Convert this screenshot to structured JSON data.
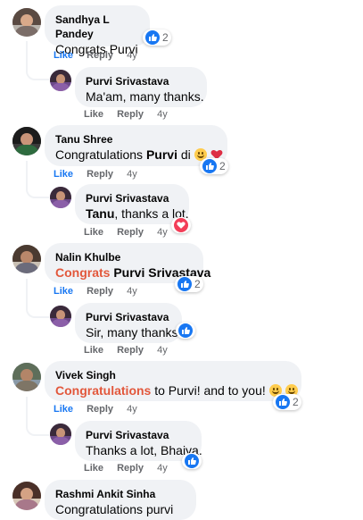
{
  "colors": {
    "accent": "#1877f2",
    "highlight": "#e2573b",
    "bubble": "#f0f2f5",
    "muted": "#65676b",
    "love": "#f33e58"
  },
  "actions": {
    "like": "Like",
    "reply": "Reply"
  },
  "comments": [
    {
      "author": "Sandhya L Pandey",
      "text": "Congrats Purvi",
      "age": "4y",
      "reaction_count": "2",
      "reaction": "like-icon"
    },
    {
      "author": "Purvi Srivastava",
      "text": "Ma'am, many thanks.",
      "age": "4y"
    },
    {
      "author": "Tanu Shree",
      "text_plain": "Congratulations ",
      "text_bold": "Purvi",
      "text_suffix": " di",
      "age": "4y",
      "reaction_count": "2",
      "emojis": [
        "smile-emoji-icon",
        "heart-emoji-icon"
      ]
    },
    {
      "author": "Purvi Srivastava",
      "text_bold": "Tanu",
      "text_rest": ", thanks a lot.",
      "age": "4y",
      "reaction": "love-icon"
    },
    {
      "author": "Nalin Khulbe",
      "text_hl": "Congrats",
      "text_bold": " Purvi Srivastava",
      "age": "4y",
      "reaction_count": "2"
    },
    {
      "author": "Purvi Srivastava",
      "text": "Sir, many thanks.",
      "age": "4y",
      "reaction": "like-icon"
    },
    {
      "author": "Vivek Singh",
      "text_hl": "Congratulations",
      "text_rest": " to Purvi! and to you! ",
      "age": "4y",
      "reaction_count": "2",
      "emojis": [
        "smile-emoji-icon",
        "smile-emoji-icon"
      ]
    },
    {
      "author": "Purvi Srivastava",
      "text": "Thanks a lot, Bhaiya.",
      "age": "4y",
      "reaction": "like-icon"
    },
    {
      "author": "Rashmi Ankit Sinha",
      "text": "Congratulations purvi"
    }
  ]
}
